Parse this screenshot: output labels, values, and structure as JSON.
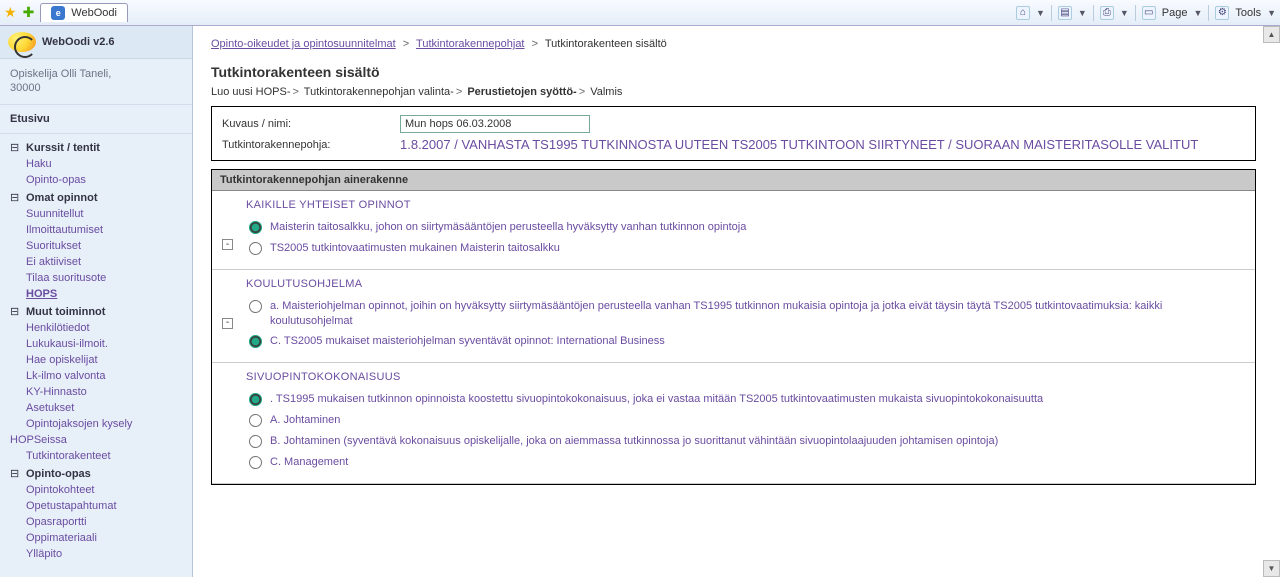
{
  "ie": {
    "tab_title": "WebOodi",
    "menu_page": "Page",
    "menu_tools": "Tools"
  },
  "sidebar": {
    "app_title": "WebOodi v2.6",
    "user_line1": "Opiskelija Olli Taneli,",
    "user_line2": "30000",
    "home": "Etusivu",
    "sections": [
      {
        "label": "Kurssit / tentit",
        "items": [
          "Haku",
          "Opinto-opas"
        ]
      },
      {
        "label": "Omat opinnot",
        "items": [
          "Suunnitellut",
          "Ilmoittautumiset",
          "Suoritukset",
          "Ei aktiiviset",
          "Tilaa suoritusote",
          "HOPS"
        ]
      },
      {
        "label": "Muut toiminnot",
        "items": [
          "Henkilötiedot",
          "Lukukausi-ilmoit.",
          "Hae opiskelijat",
          "Lk-ilmo valvonta",
          "KY-Hinnasto",
          "Asetukset",
          "Opintojaksojen kysely HOPSeissa",
          "Tutkintorakenteet"
        ]
      },
      {
        "label": "Opinto-opas",
        "items": [
          "Opintokohteet",
          "Opetustapahtumat",
          "Opasraportti",
          "Oppimateriaali",
          "Ylläpito"
        ]
      }
    ]
  },
  "breadcrumb": {
    "a": "Opinto-oikeudet ja opintosuunnitelmat",
    "b": "Tutkintorakennepohjat",
    "c": "Tutkintorakenteen sisältö"
  },
  "page_title": "Tutkintorakenteen sisältö",
  "wizard": {
    "s1": "Luo uusi HOPS-",
    "s2": "Tutkintorakennepohjan valinta-",
    "s3": "Perustietojen syöttö-",
    "s4": "Valmis"
  },
  "info": {
    "kuvaus_label": "Kuvaus / nimi:",
    "kuvaus_value": "Mun hops 06.03.2008",
    "pohja_label": "Tutkintorakennepohja:",
    "pohja_value": "1.8.2007 / VANHASTA TS1995 TUTKINNOSTA UUTEEN TS2005 TUTKINTOON SIIRTYNEET / SUORAAN MAISTERITASOLLE VALITUT"
  },
  "structure": {
    "header": "Tutkintorakennepohjan ainerakenne",
    "groups": [
      {
        "title": "KAIKILLE YHTEISET OPINNOT",
        "collapsible": true,
        "options": [
          {
            "label": "Maisterin taitosalkku, johon on siirtymäsääntöjen perusteella hyväksytty vanhan tutkinnon opintoja",
            "checked": true
          },
          {
            "label": "TS2005 tutkintovaatimusten mukainen Maisterin taitosalkku",
            "checked": false
          }
        ]
      },
      {
        "title": "KOULUTUSOHJELMA",
        "collapsible": true,
        "options": [
          {
            "label": "a. Maisteriohjelman opinnot, joihin on hyväksytty siirtymäsääntöjen perusteella vanhan TS1995 tutkinnon mukaisia opintoja ja jotka eivät täysin täytä TS2005 tutkintovaatimuksia: kaikki koulutusohjelmat",
            "checked": false
          },
          {
            "label": "C. TS2005 mukaiset maisteriohjelman syventävät opinnot: International Business",
            "checked": true
          }
        ]
      },
      {
        "title": "SIVUOPINTOKOKONAISUUS",
        "collapsible": false,
        "options": [
          {
            "label": ". TS1995 mukaisen tutkinnon opinnoista koostettu sivuopintokokonaisuus, joka ei vastaa mitään TS2005 tutkintovaatimusten mukaista sivuopintokokonaisuutta",
            "checked": true
          },
          {
            "label": "A. Johtaminen",
            "checked": false
          },
          {
            "label": "B. Johtaminen (syventävä kokonaisuus opiskelijalle, joka on aiemmassa tutkinnossa jo suorittanut vähintään sivuopintolaajuuden johtamisen opintoja)",
            "checked": false
          },
          {
            "label": "C. Management",
            "checked": false
          }
        ]
      }
    ]
  }
}
